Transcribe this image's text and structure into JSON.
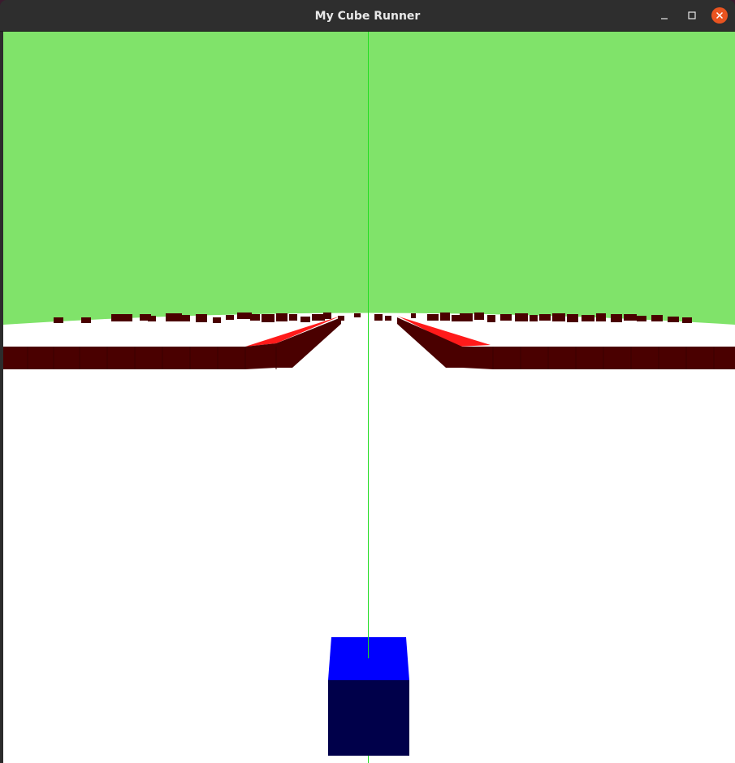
{
  "window": {
    "title": "My Cube Runner"
  },
  "titlebar": {
    "minimize_icon": "minimize-icon",
    "maximize_icon": "maximize-icon",
    "close_icon": "close-icon"
  },
  "scene": {
    "colors": {
      "sky": "#80e36a",
      "ground": "#ffffff",
      "obstacle_front": "#4a0000",
      "obstacle_top": "#ff1a1a",
      "player_top": "#0000ff",
      "player_front": "#00004a",
      "guide_line": "#22dd22",
      "close_button": "#e95420"
    }
  }
}
